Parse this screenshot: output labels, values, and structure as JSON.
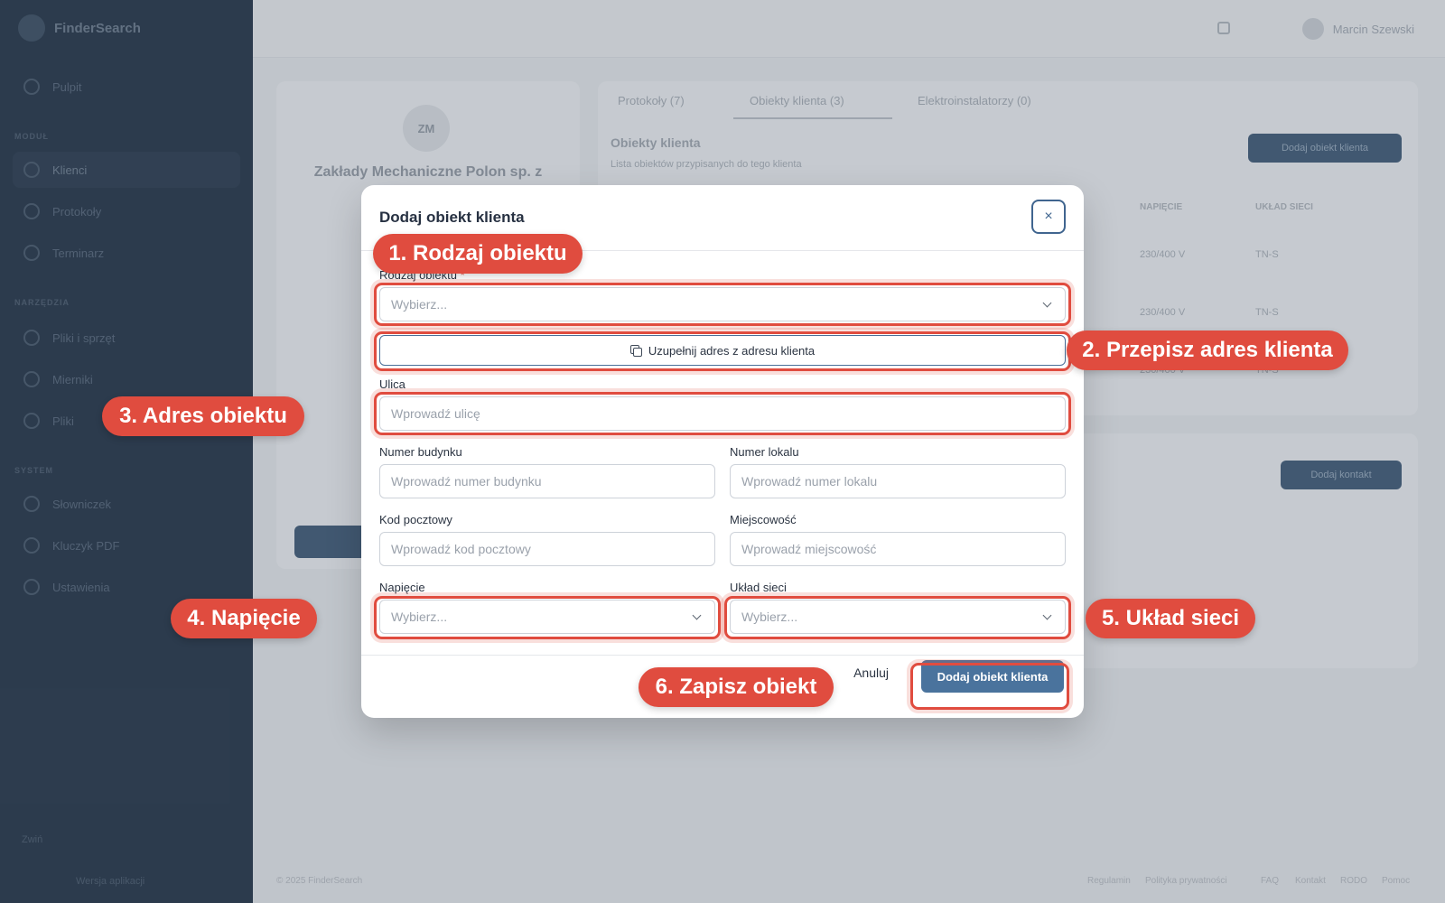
{
  "app": {
    "brand": "FinderSearch",
    "sidebar": {
      "items": [
        {
          "label": "Pulpit"
        },
        {
          "label": "Klienci"
        },
        {
          "label": "Protokoły"
        },
        {
          "label": "Terminarz"
        },
        {
          "label": "Pliki i sprzęt"
        },
        {
          "label": "Mierniki"
        },
        {
          "label": "Pliki"
        },
        {
          "label": "Słowniczek"
        },
        {
          "label": "Kluczyk PDF"
        },
        {
          "label": "Ustawienia"
        }
      ],
      "sections": [
        "MODUŁ",
        "NARZĘDZIA",
        "SYSTEM"
      ],
      "footer_link": "Zwiń",
      "footer_note": "Wersja aplikacji"
    },
    "topbar": {
      "user_name": "Marcin Szewski"
    },
    "profile": {
      "initials": "ZM",
      "company": "Zakłady Mechaniczne Polon sp. z"
    },
    "tabs": [
      "Protokoły (7)",
      "Obiekty klienta (3)",
      "Elektroinstalatorzy (0)"
    ],
    "objects": {
      "title": "Obiekty klienta",
      "subtitle": "Lista obiektów przypisanych do tego klienta",
      "add_button": "Dodaj obiekt klienta",
      "columns": [
        "NAPIĘCIE",
        "UKŁAD SIECI"
      ],
      "rows": [
        {
          "voltage": "230/400 V",
          "network": "TN-S"
        },
        {
          "voltage": "230/400 V",
          "network": "TN-S"
        },
        {
          "voltage": "230/400 V",
          "network": "TN-S"
        }
      ]
    },
    "contacts_button": "Dodaj kontakt",
    "footer": {
      "copyright": "© 2025 FinderSearch",
      "links": [
        "Regulamin",
        "Polityka prywatności",
        "FAQ",
        "Kontakt",
        "RODO",
        "Pomoc"
      ]
    }
  },
  "modal": {
    "title": "Dodaj obiekt klienta",
    "close_symbol": "×",
    "object_type": {
      "label": "Rodzaj obiektu",
      "required_mark": "*",
      "placeholder": "Wybierz..."
    },
    "fill_button": "Uzupełnij adres z adresu klienta",
    "street": {
      "label": "Ulica",
      "placeholder": "Wprowadź ulicę"
    },
    "building_number": {
      "label": "Numer budynku",
      "placeholder": "Wprowadź numer budynku"
    },
    "apartment_number": {
      "label": "Numer lokalu",
      "placeholder": "Wprowadź numer lokalu"
    },
    "postal_code": {
      "label": "Kod pocztowy",
      "placeholder": "Wprowadź kod pocztowy"
    },
    "city": {
      "label": "Miejscowość",
      "placeholder": "Wprowadź miejscowość"
    },
    "voltage": {
      "label": "Napięcie",
      "placeholder": "Wybierz..."
    },
    "network_system": {
      "label": "Układ sieci",
      "placeholder": "Wybierz..."
    },
    "cancel_label": "Anuluj",
    "submit_label": "Dodaj obiekt klienta"
  },
  "annotations": {
    "step1": "1. Rodzaj obiektu",
    "step2": "2. Przepisz adres klienta",
    "step3": "3. Adres obiektu",
    "step4": "4. Napięcie",
    "step5": "5. Układ sieci",
    "step6": "6. Zapisz obiekt"
  },
  "colors": {
    "accent": "#4a739d",
    "annotation": "#e04c3f",
    "sidebar": "#1c2f45"
  }
}
